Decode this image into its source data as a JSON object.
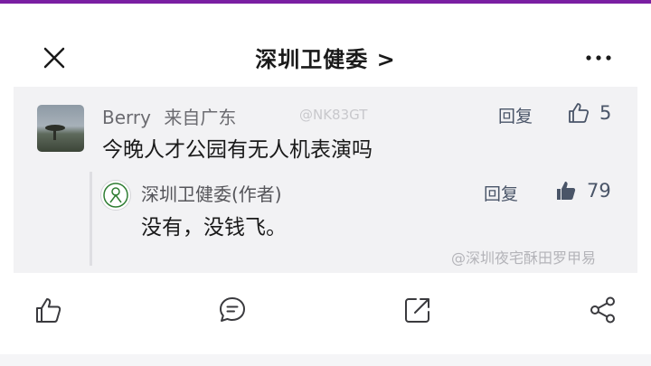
{
  "header": {
    "title": "深圳卫健委 >",
    "close_icon": "close-icon",
    "more_icon": "more-dots-icon"
  },
  "comment": {
    "user": "Berry",
    "location": "来自广东",
    "watermark": "@NK83GT",
    "reply_label": "回复",
    "like_count": "5",
    "text": "今晚人才公园有无人机表演吗"
  },
  "reply": {
    "author": "深圳卫健委(作者)",
    "reply_label": "回复",
    "like_count": "79",
    "text": "没有，没钱飞。",
    "watermark": "@深圳夜宅酥田罗甲易"
  },
  "toolbar": {
    "icons": [
      "like-icon",
      "comment-icon",
      "repost-icon",
      "share-icon"
    ]
  },
  "colors": {
    "accent_bar": "#7a1fa2",
    "panel": "#f2f2f4",
    "secondary_text": "#4a5568"
  }
}
